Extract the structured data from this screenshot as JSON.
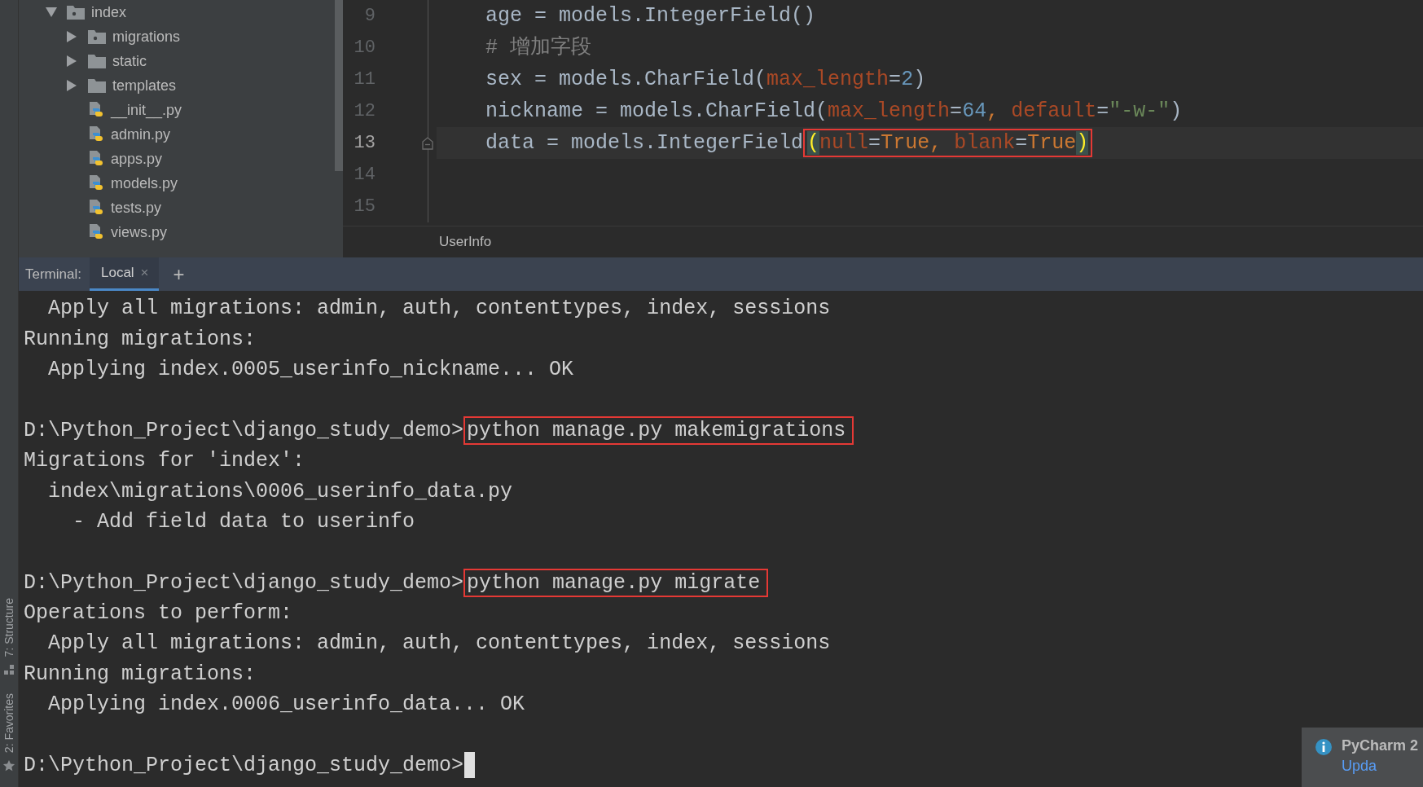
{
  "tool_strip": {
    "tabs": [
      {
        "label": "7: Structure",
        "kind": "structure"
      },
      {
        "label": "2: Favorites",
        "kind": "favorites"
      }
    ]
  },
  "project_tree": {
    "items": [
      {
        "label": "index",
        "kind": "package",
        "expanded": true,
        "selected": false,
        "children": [
          {
            "label": "migrations",
            "kind": "package",
            "expanded": false,
            "selected": false
          },
          {
            "label": "static",
            "kind": "folder",
            "expanded": false,
            "selected": false
          },
          {
            "label": "templates",
            "kind": "folder",
            "expanded": false,
            "selected": false
          },
          {
            "label": "__init__.py",
            "kind": "python",
            "selected": false
          },
          {
            "label": "admin.py",
            "kind": "python",
            "selected": false
          },
          {
            "label": "apps.py",
            "kind": "python",
            "selected": false
          },
          {
            "label": "models.py",
            "kind": "python",
            "selected": false
          },
          {
            "label": "tests.py",
            "kind": "python",
            "selected": false
          },
          {
            "label": "views.py",
            "kind": "python",
            "selected": false
          }
        ]
      }
    ]
  },
  "editor": {
    "lines": [
      {
        "number": "9",
        "current": false,
        "fold": false,
        "tokens": [
          {
            "text": "    age = models.IntegerField()",
            "kind": "plain"
          }
        ]
      },
      {
        "number": "10",
        "current": false,
        "fold": false,
        "tokens": [
          {
            "text": "    # 增加字段",
            "kind": "comment"
          }
        ]
      },
      {
        "number": "11",
        "current": false,
        "fold": false,
        "tokens": [
          {
            "text": "    sex = models.CharField(",
            "kind": "plain"
          },
          {
            "text": "max_length",
            "kind": "param"
          },
          {
            "text": "=",
            "kind": "plain"
          },
          {
            "text": "2",
            "kind": "number"
          },
          {
            "text": ")",
            "kind": "plain"
          }
        ]
      },
      {
        "number": "12",
        "current": false,
        "fold": false,
        "tokens": [
          {
            "text": "    nickname = models.CharField(",
            "kind": "plain"
          },
          {
            "text": "max_length",
            "kind": "param"
          },
          {
            "text": "=",
            "kind": "plain"
          },
          {
            "text": "64",
            "kind": "number"
          },
          {
            "text": ", ",
            "kind": "keyword"
          },
          {
            "text": "default",
            "kind": "param"
          },
          {
            "text": "=",
            "kind": "plain"
          },
          {
            "text": "\"-w-\"",
            "kind": "string"
          },
          {
            "text": ")",
            "kind": "plain"
          }
        ]
      },
      {
        "number": "13",
        "current": true,
        "fold": true,
        "tokens": [
          {
            "text": "    data = models.IntegerField",
            "kind": "plain"
          }
        ],
        "boxed_tokens": [
          {
            "text": "(",
            "kind": "brace"
          },
          {
            "text": "null",
            "kind": "param"
          },
          {
            "text": "=",
            "kind": "plain"
          },
          {
            "text": "True",
            "kind": "keyword"
          },
          {
            "text": ", ",
            "kind": "keyword"
          },
          {
            "text": "blank",
            "kind": "param"
          },
          {
            "text": "=",
            "kind": "plain"
          },
          {
            "text": "True",
            "kind": "keyword"
          },
          {
            "text": ")",
            "kind": "brace"
          }
        ]
      },
      {
        "number": "14",
        "current": false,
        "fold": false
      },
      {
        "number": "15",
        "current": false,
        "fold": false
      }
    ],
    "breadcrumb": "UserInfo"
  },
  "terminal": {
    "label": "Terminal:",
    "tabs": [
      {
        "label": "Local",
        "close": "×",
        "selected": true
      }
    ],
    "add": "+",
    "lines": [
      {
        "kind": "output",
        "text": "  Apply all migrations: admin, auth, contenttypes, index, sessions"
      },
      {
        "kind": "output",
        "text": "Running migrations:"
      },
      {
        "kind": "output",
        "text": "  Applying index.0005_userinfo_nickname... OK"
      },
      {
        "kind": "blank"
      },
      {
        "kind": "prompt",
        "text": "D:\\Python_Project\\django_study_demo>",
        "command": "python manage.py makemigrations",
        "boxed": true
      },
      {
        "kind": "output",
        "text": "Migrations for 'index':"
      },
      {
        "kind": "output",
        "text": "  index\\migrations\\0006_userinfo_data.py"
      },
      {
        "kind": "output",
        "text": "    - Add field data to userinfo"
      },
      {
        "kind": "blank"
      },
      {
        "kind": "prompt",
        "text": "D:\\Python_Project\\django_study_demo>",
        "command": "python manage.py migrate",
        "boxed": true
      },
      {
        "kind": "output",
        "text": "Operations to perform:"
      },
      {
        "kind": "output",
        "text": "  Apply all migrations: admin, auth, contenttypes, index, sessions"
      },
      {
        "kind": "output",
        "text": "Running migrations:"
      },
      {
        "kind": "output",
        "text": "  Applying index.0006_userinfo_data... OK"
      },
      {
        "kind": "blank"
      },
      {
        "kind": "prompt",
        "text": "D:\\Python_Project\\django_study_demo>",
        "cursor": true
      }
    ]
  },
  "notification": {
    "title": "PyCharm 2",
    "link": "Upda"
  }
}
